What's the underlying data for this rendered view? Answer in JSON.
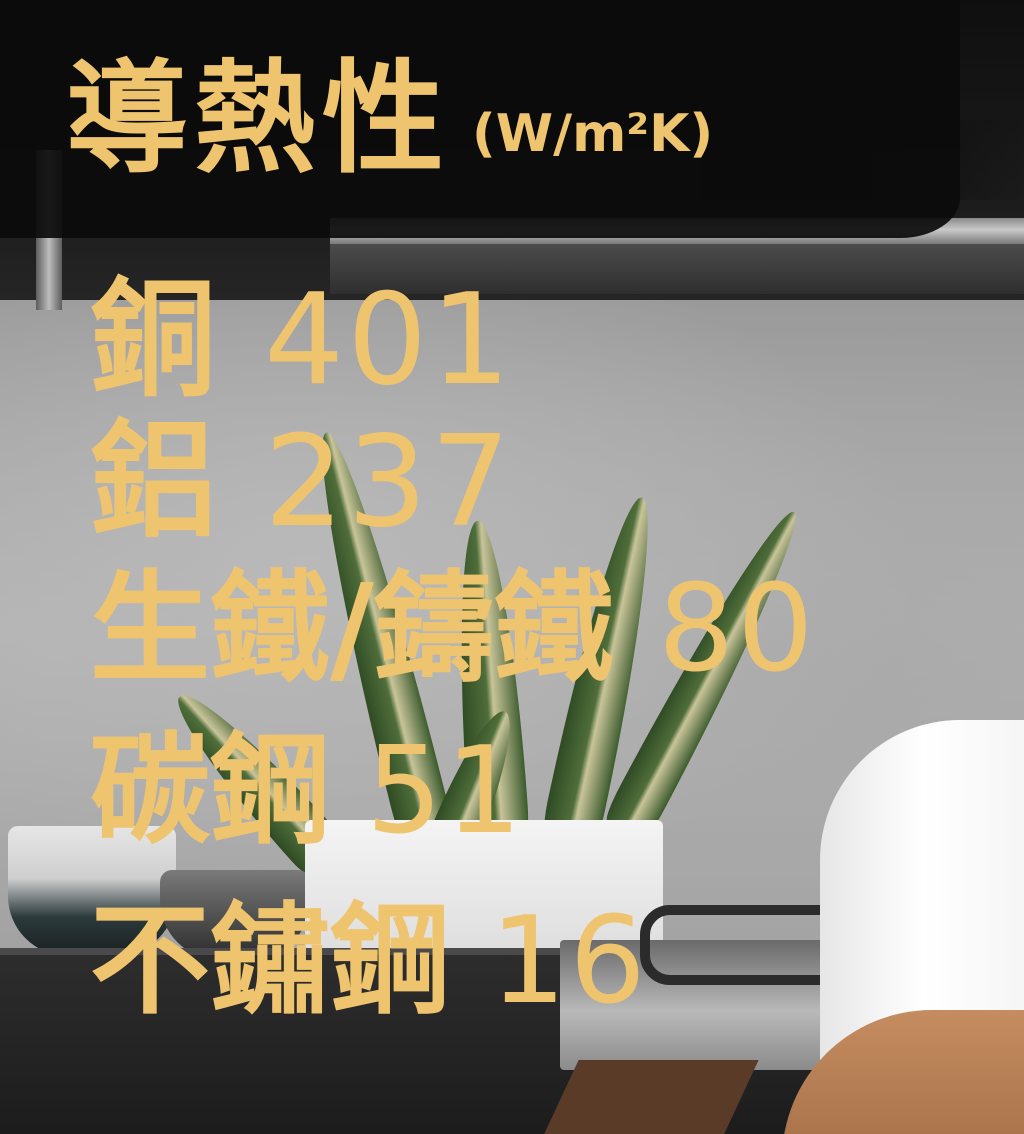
{
  "overlay": {
    "title": "導熱性",
    "unit": "(W/m²K)",
    "text_color": "#efc46f",
    "materials": [
      {
        "name": "銅",
        "value": "401"
      },
      {
        "name": "鋁",
        "value": "237"
      },
      {
        "name": "生鐵/鑄鐵",
        "value": "80"
      },
      {
        "name": "碳鋼",
        "value": "51"
      },
      {
        "name": "不鏽鋼",
        "value": "16"
      }
    ]
  }
}
